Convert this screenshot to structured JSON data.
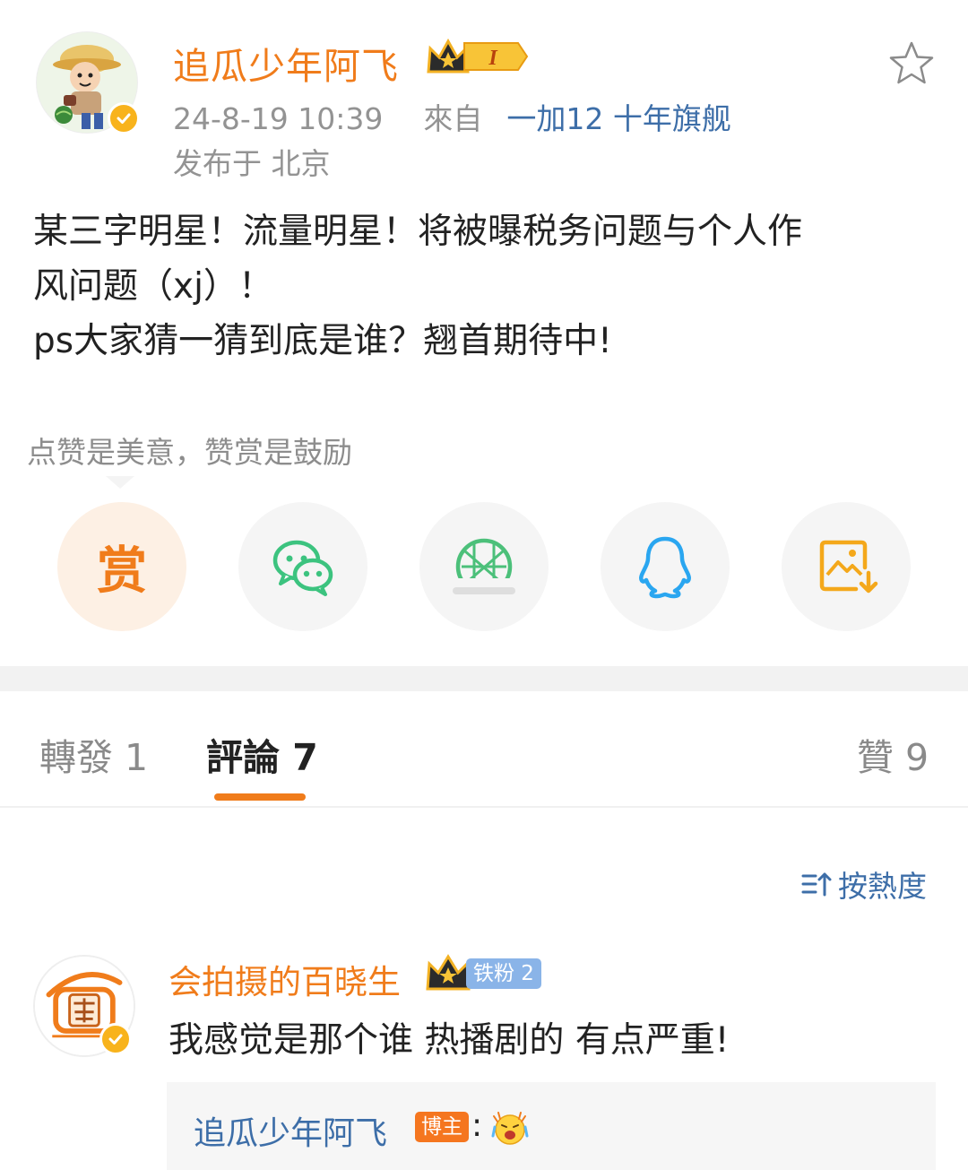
{
  "post": {
    "author": "追瓜少年阿飞",
    "level_badge": "I",
    "timestamp": "24-8-19 10:39",
    "source_prefix": "來自",
    "device": "一加12 十年旗舰",
    "location": "发布于 北京",
    "body_lines": [
      "某三字明星！流量明星！将被曝税务问题与个人作",
      "风问题（xj）！",
      "ps大家猜一猜到底是谁？翘首期待中!"
    ]
  },
  "reward": {
    "hint": "点赞是美意，赞赏是鼓励",
    "reward_char": "赏"
  },
  "share_icons": [
    "reward-icon",
    "wechat-icon",
    "moments-icon",
    "qq-icon",
    "save-image-icon"
  ],
  "tabs": [
    {
      "label": "轉發 1"
    },
    {
      "label": "評論 7"
    },
    {
      "label": "贊 9"
    }
  ],
  "sort": {
    "label": "按熱度"
  },
  "comment": {
    "author": "会拍摄的百晓生",
    "fan_badge": "铁粉 2",
    "text": "我感觉是那个谁 热播剧的 有点严重!",
    "reply": {
      "author": "追瓜少年阿飞",
      "tag": "博主",
      "separator": ":"
    }
  },
  "colors": {
    "accent": "#f07c1b",
    "link": "#3d6ea8",
    "muted": "#939393"
  }
}
